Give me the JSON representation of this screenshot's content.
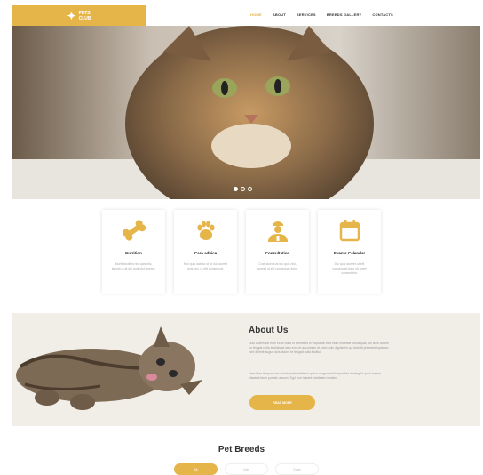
{
  "header": {
    "logo_line1": "PETS",
    "logo_line2": "CLUB",
    "nav": [
      "HOME",
      "ABOUT",
      "SERVICES",
      "BREEDS GALLERY",
      "CONTACTS"
    ],
    "nav_active": "HOME"
  },
  "hero": {
    "slide_count": 3,
    "active_slide": 1
  },
  "features": [
    {
      "title": "Nutrition",
      "icon": "bone-icon",
      "text": "Morbi facilisis nisi quis nisi, lacinia ut at dui quis nisl laoreet."
    },
    {
      "title": "Care advice",
      "icon": "paw-icon",
      "text": "Nisi quis lacinia ut at dui laoreet quis nisl, ut elit consequat."
    },
    {
      "title": "Consultation",
      "icon": "vet-icon",
      "text": "Cras lacinia at dui quis nisl, laoreet ut elit consequat dolor."
    },
    {
      "title": "Events Calendar",
      "icon": "calendar-icon",
      "text": "Dui quis laoreet ut elit consequat dolor sit amet consectetur."
    }
  ],
  "about": {
    "title": "About Us",
    "paragraph1": "Duis autem vel eum iriure dolor in hendrerit in vulputate velit esse molestie consequat, vel illum dolore eu feugiat nulla facilisis at vero eros et accumsan et iusto odio dignissim qui blandit praesent luptatum zzril delenit augue duis dolore te feugait nulla facilisi.",
    "paragraph2": "Nam liber tempor cum soluta nobis eleifend option congue nihil imperdiet doming id quod mazim placerat facer possim assum. Typi non habent claritatem insitam.",
    "button": "READ MORE"
  },
  "breeds": {
    "title": "Pet Breeds",
    "tabs": [
      "All",
      "Cats",
      "Dogs"
    ],
    "active_tab": "All"
  },
  "colors": {
    "accent": "#e6b54a",
    "about_bg": "#f1eee8"
  }
}
